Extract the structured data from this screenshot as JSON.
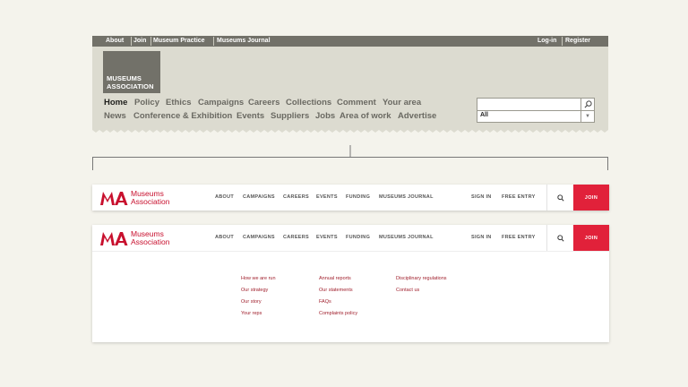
{
  "old_site": {
    "topbar": {
      "left_links": [
        "About",
        "Join",
        "Museum Practice",
        "Museums Journal"
      ],
      "right_links": [
        "Log-in",
        "Register"
      ]
    },
    "logo": [
      "MUSEUMS",
      "ASSOCIATION"
    ],
    "nav_row1": [
      "Home",
      "Policy",
      "Ethics",
      "Campaigns",
      "Careers",
      "Collections",
      "Comment",
      "Your area"
    ],
    "nav_row2": [
      "News",
      "Conference & Exhibition",
      "Events",
      "Suppliers",
      "Jobs",
      "Area of work",
      "Advertise"
    ],
    "search": {
      "value": "",
      "select": "All"
    }
  },
  "new_site": {
    "logo_name": [
      "Museums",
      "Association"
    ],
    "nav": [
      "ABOUT",
      "CAMPAIGNS",
      "CAREERS",
      "EVENTS",
      "FUNDING",
      "MUSEUMS JOURNAL"
    ],
    "right_nav": [
      "SIGN IN",
      "FREE ENTRY"
    ],
    "join": "JOIN",
    "dropdown_columns": [
      [
        "How we are run",
        "Our strategy",
        "Our story",
        "Your reps"
      ],
      [
        "Annual reports",
        "Our statements",
        "FAQs",
        "Complaints policy"
      ],
      [
        "Disciplinary regulations",
        "Contact us"
      ]
    ]
  },
  "colors": {
    "brand_red": "#c8102e",
    "join_red": "#e1213a",
    "old_grey": "#727169",
    "old_bg": "#dcdbd0"
  },
  "icons": [
    "search-icon",
    "chevron-down-icon",
    "ma-logo-icon"
  ]
}
